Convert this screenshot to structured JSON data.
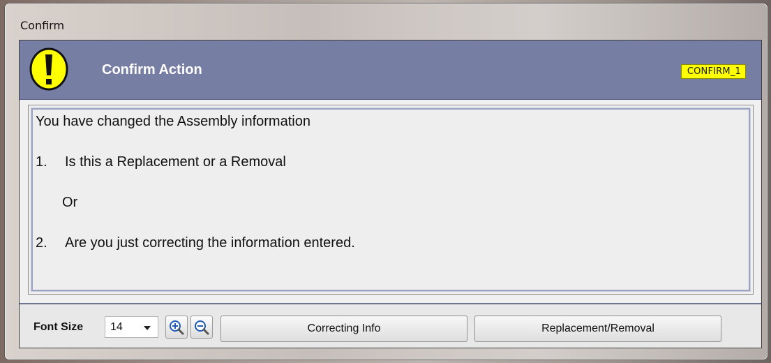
{
  "window": {
    "title": "Confirm"
  },
  "header": {
    "title": "Confirm Action",
    "code": "CONFIRM_1",
    "icon": "warning-icon",
    "colors": {
      "bar": "#767ea4",
      "badge": "#ffff00",
      "icon": "#ffff00"
    }
  },
  "message": {
    "lines": [
      {
        "number": "",
        "text": "You have changed the Assembly information"
      },
      {
        "number": "1.",
        "text": "Is this a Replacement or a Removal"
      },
      {
        "number": "",
        "text": "Or"
      },
      {
        "number": "2.",
        "text": "Are you just correcting the information entered."
      }
    ]
  },
  "footer": {
    "font_size_label": "Font Size",
    "font_size_value": "14",
    "zoom_in_icon": "zoom-in-icon",
    "zoom_out_icon": "zoom-out-icon",
    "buttons": {
      "correcting": "Correcting Info",
      "replacement": "Replacement/Removal"
    }
  }
}
